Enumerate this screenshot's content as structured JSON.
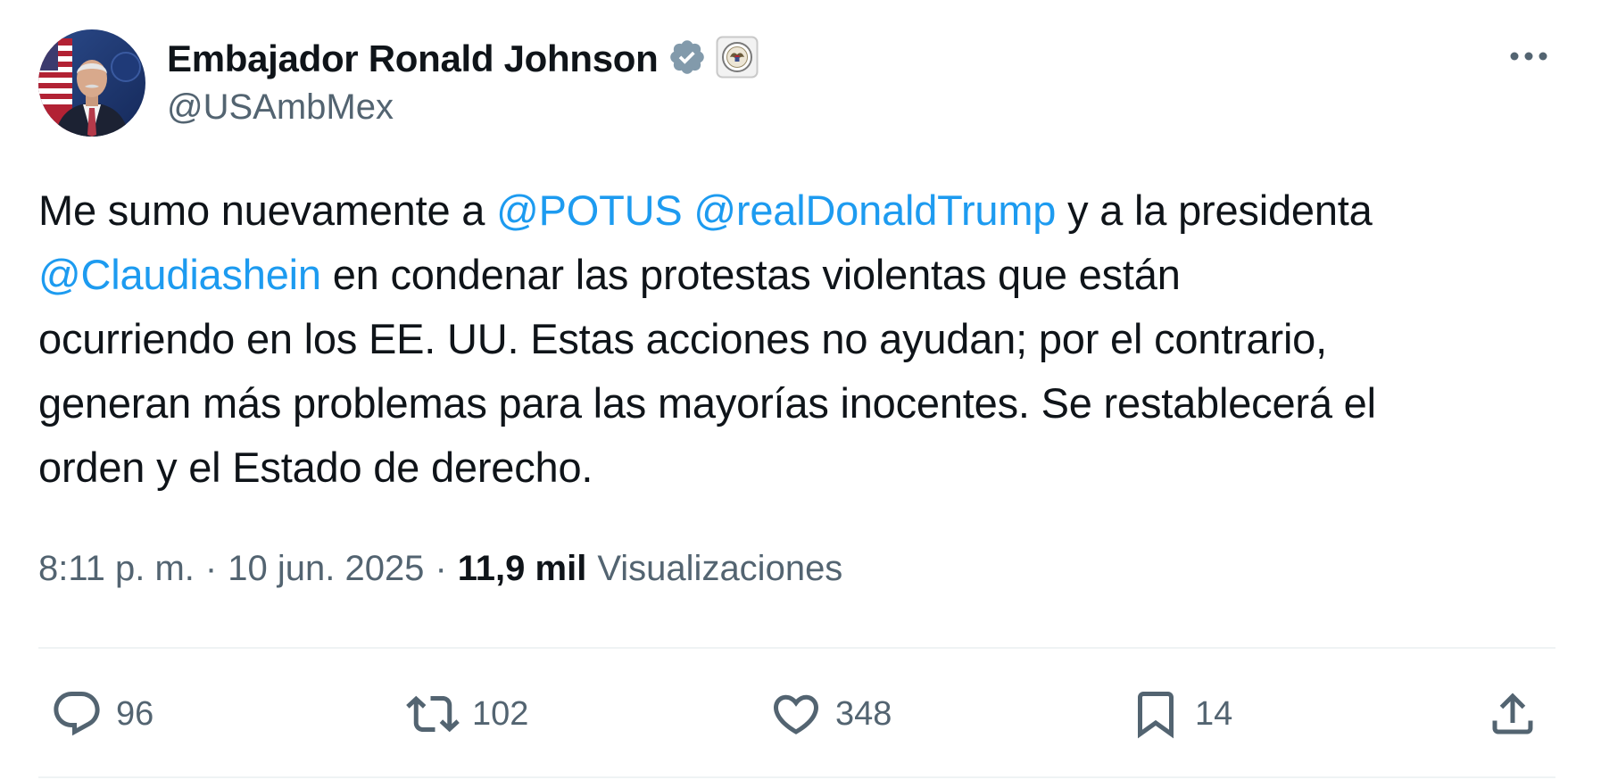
{
  "author": {
    "display_name": "Embajador Ronald Johnson",
    "handle": "@USAmbMex",
    "verified_icon": "verified-badge-icon",
    "affiliate_icon": "state-department-seal-icon"
  },
  "tweet": {
    "lines": [
      [
        {
          "text": "Me sumo nuevamente a ",
          "type": "text"
        },
        {
          "text": "@POTUS",
          "type": "mention"
        },
        {
          "text": " ",
          "type": "text"
        },
        {
          "text": "@realDonaldTrump",
          "type": "mention"
        },
        {
          "text": " y a la presidenta",
          "type": "text"
        }
      ],
      [
        {
          "text": "@Claudiashein",
          "type": "mention"
        },
        {
          "text": " en condenar las protestas violentas que están",
          "type": "text"
        }
      ],
      [
        {
          "text": "ocurriendo en los EE. UU. Estas acciones no ayudan; por el contrario,",
          "type": "text"
        }
      ],
      [
        {
          "text": "generan más problemas para las mayorías inocentes. Se restablecerá el",
          "type": "text"
        }
      ],
      [
        {
          "text": "orden y el Estado de derecho.",
          "type": "text"
        }
      ]
    ]
  },
  "meta": {
    "time": "8:11 p. m.",
    "separator": "·",
    "date": "10 jun. 2025",
    "views_count": "11,9 mil",
    "views_label": "Visualizaciones"
  },
  "actions": {
    "reply_count": "96",
    "repost_count": "102",
    "like_count": "348",
    "bookmark_count": "14"
  },
  "colors": {
    "link": "#1d9bf0",
    "secondary_text": "#536471",
    "primary_text": "#0f1419",
    "divider": "#eff3f4",
    "verified_badge": "#829aab"
  }
}
